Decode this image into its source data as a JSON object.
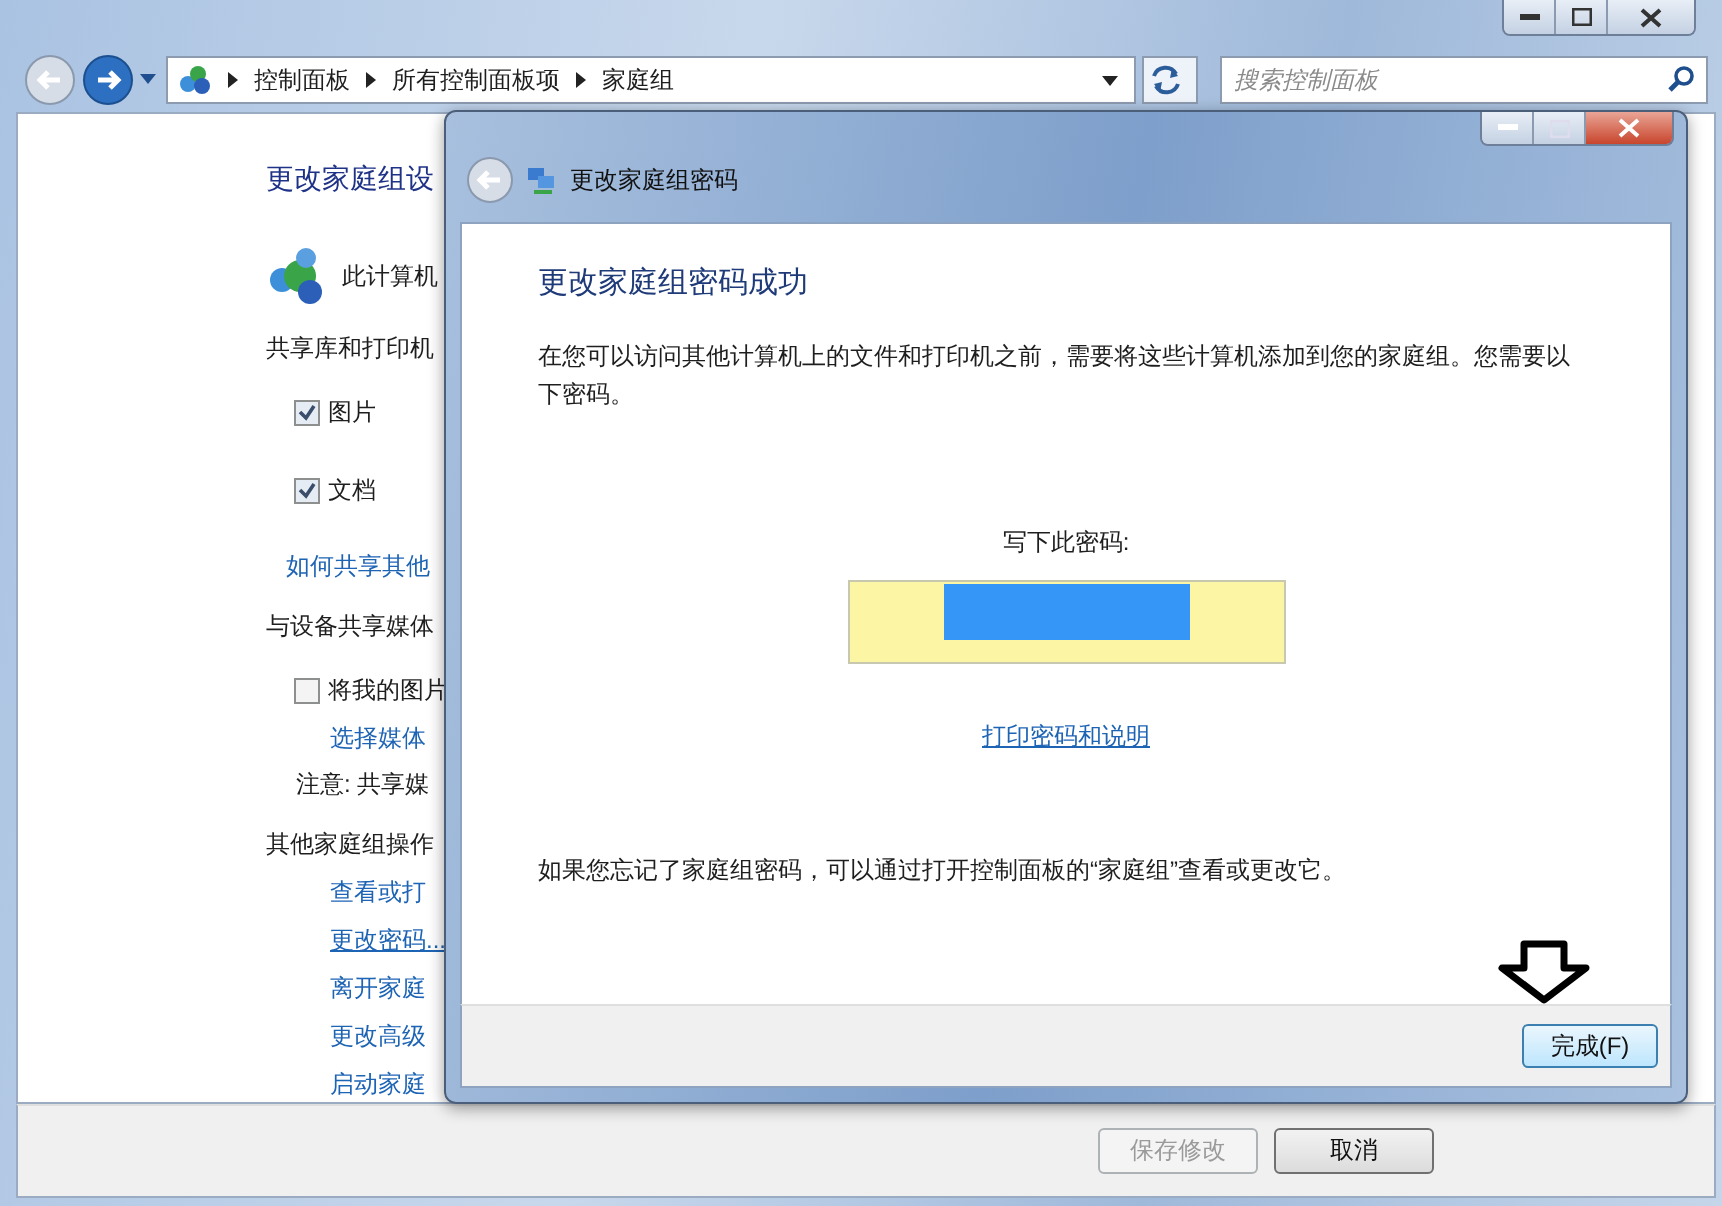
{
  "main_window": {
    "address": {
      "crumbs": [
        "控制面板",
        "所有控制面板项",
        "家庭组"
      ]
    },
    "search": {
      "placeholder": "搜索控制面板"
    },
    "items": [
      {
        "kind": "heading",
        "text": "更改家庭组设"
      },
      {
        "kind": "computer",
        "text": "此计算机"
      },
      {
        "kind": "label",
        "text": "共享库和打印机"
      },
      {
        "kind": "checkbox",
        "text": "图片",
        "checked": true
      },
      {
        "kind": "checkbox",
        "text": "文档",
        "checked": true
      },
      {
        "kind": "link",
        "text": "如何共享其他"
      },
      {
        "kind": "label",
        "text": "与设备共享媒体"
      },
      {
        "kind": "checkbox",
        "text": "将我的图片",
        "checked": false
      },
      {
        "kind": "sublink",
        "text": "选择媒体"
      },
      {
        "kind": "note",
        "text": "注意: 共享媒"
      },
      {
        "kind": "label",
        "text": "其他家庭组操作"
      },
      {
        "kind": "sublink",
        "text": "查看或打"
      },
      {
        "kind": "sublink",
        "text": "更改密码...",
        "underline": true
      },
      {
        "kind": "sublink",
        "text": "离开家庭"
      },
      {
        "kind": "sublink",
        "text": "更改高级"
      },
      {
        "kind": "sublink",
        "text": "启动家庭"
      }
    ],
    "buttons": [
      {
        "label": "保存修改",
        "disabled": true
      },
      {
        "label": "取消",
        "disabled": false
      }
    ]
  },
  "dialog": {
    "title": "更改家庭组密码",
    "heading": "更改家庭组密码成功",
    "message": "在您可以访问其他计算机上的文件和打印机之前，需要将这些计算机添加到您的家庭组。您需要以下密码。",
    "password_label": "写下此密码:",
    "print_link": "打印密码和说明",
    "footer_note": "如果您忘记了家庭组密码，可以通过打开控制面板的“家庭组”查看或更改它。",
    "finish_button": "完成(F)"
  }
}
